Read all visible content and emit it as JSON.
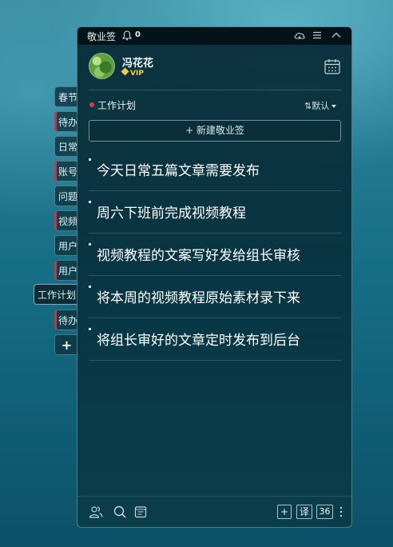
{
  "app": {
    "title": "敬业签",
    "notification_count": "0"
  },
  "user": {
    "name": "冯花花",
    "badge": "VIP"
  },
  "category": {
    "name": "工作计划",
    "sort_label": "默认",
    "sort_icon": "sort-arrows-icon"
  },
  "new_note_label": "+ 新建敬业签",
  "side_tabs": [
    {
      "label": "春节",
      "marked": false
    },
    {
      "label": "待办",
      "marked": true
    },
    {
      "label": "日常",
      "marked": false
    },
    {
      "label": "账号",
      "marked": true
    },
    {
      "label": "问题",
      "marked": false
    },
    {
      "label": "视频",
      "marked": true
    },
    {
      "label": "用户",
      "marked": false
    },
    {
      "label": "用户",
      "marked": true
    },
    {
      "label": "工作计划",
      "marked": false,
      "active": true
    },
    {
      "label": "待办",
      "marked": true
    },
    {
      "label": "+",
      "add": true
    }
  ],
  "notes": [
    "今天日常五篇文章需要发布",
    "周六下班前完成视频教程",
    "视频教程的文案写好发给组长审核",
    "将本周的视频教程原始素材录下来",
    "将组长审好的文章定时发布到后台"
  ],
  "footer": {
    "add_label": "+",
    "translate_label": "译",
    "count_label": "36"
  },
  "colors": {
    "accent_red": "#d23c55",
    "vip_gold": "#f2c94c"
  }
}
